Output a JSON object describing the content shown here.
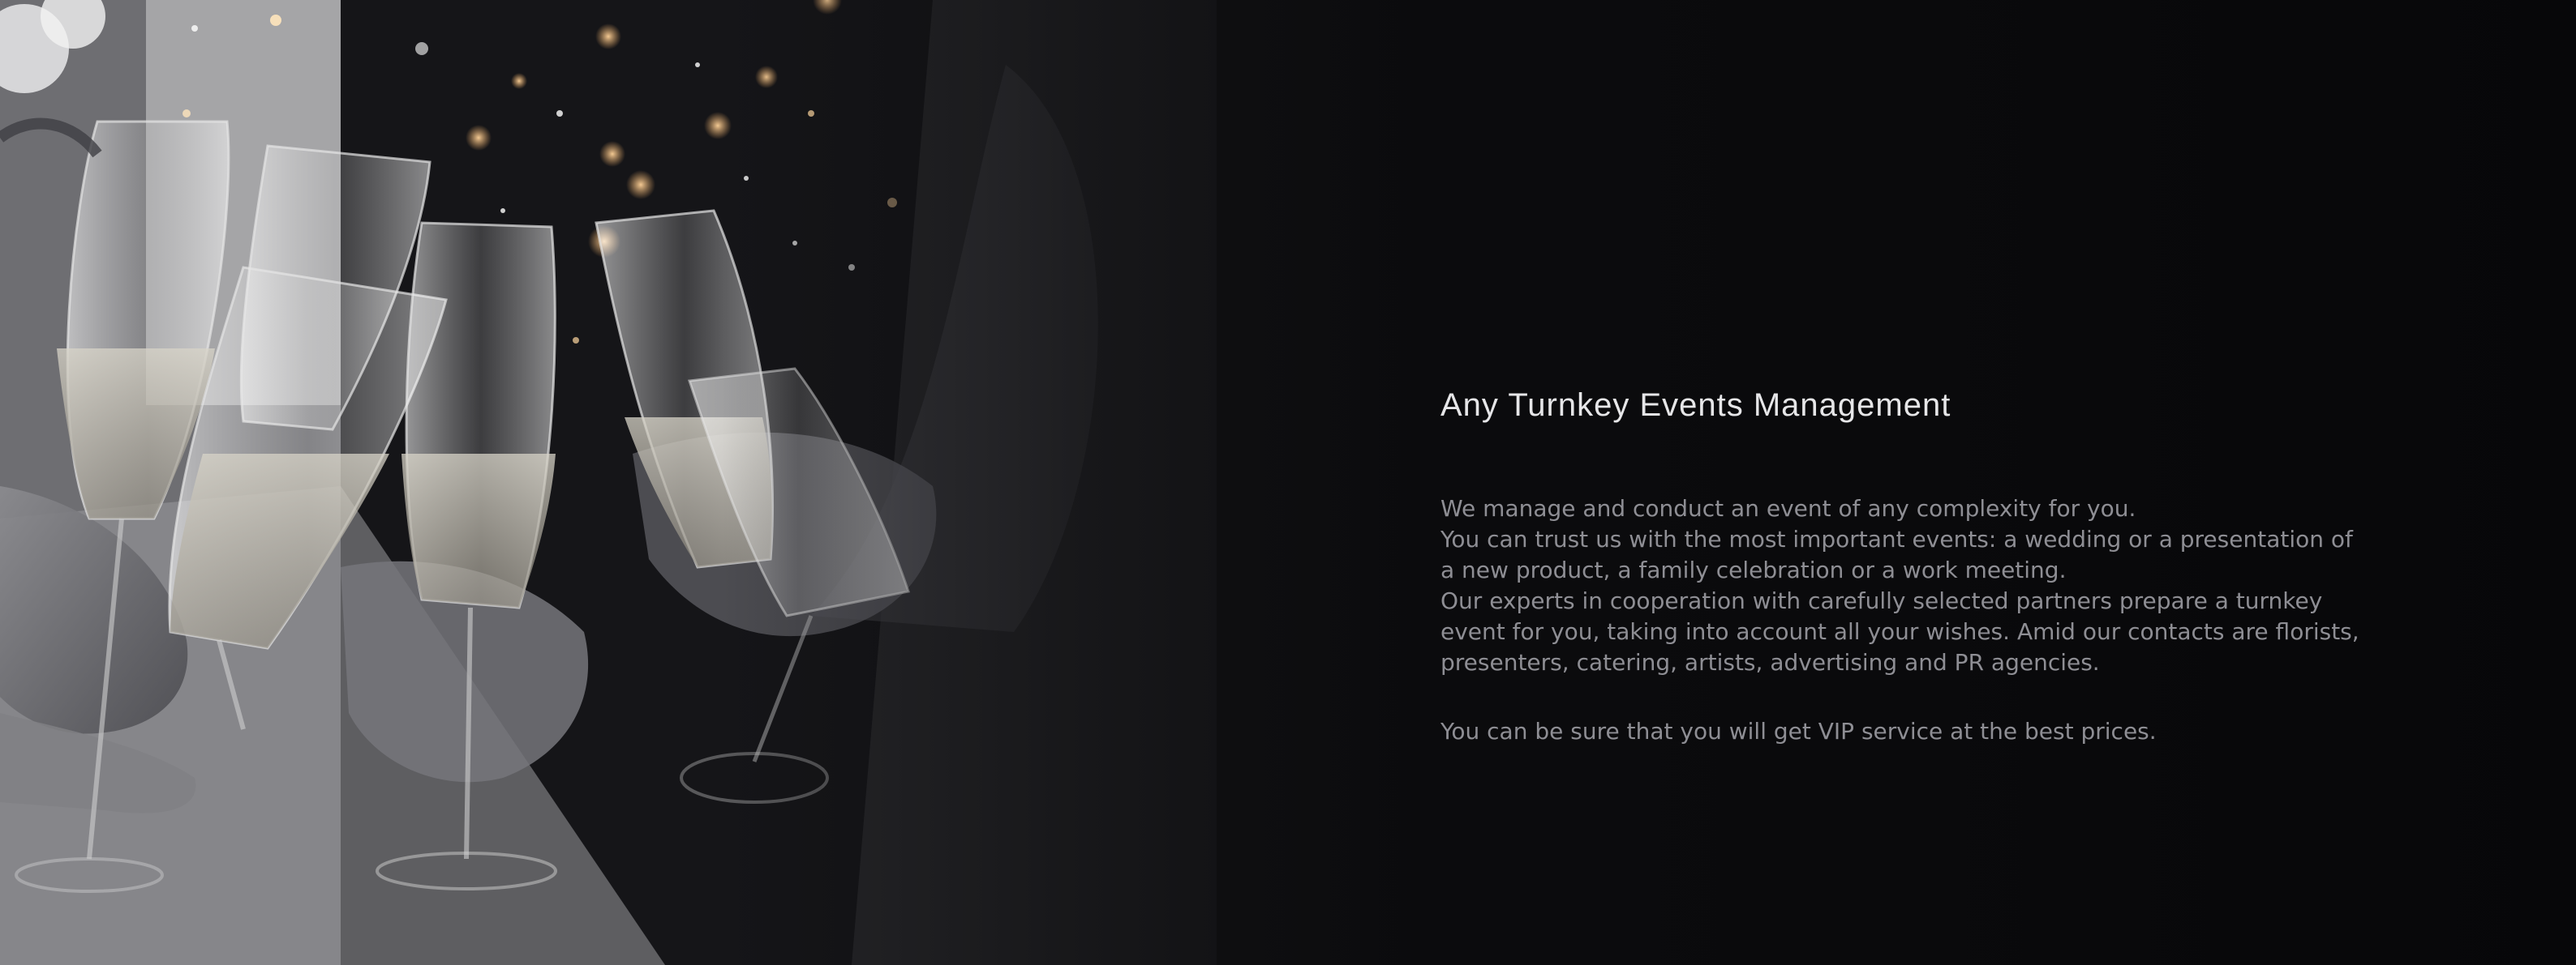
{
  "section": {
    "image": {
      "alt": "",
      "icon": "champagne-toast-photo"
    },
    "title": "Any Turnkey Events Management",
    "paragraphs": [
      [
        "We manage and conduct an event of any complexity for you.",
        "You can trust us with the most important events: a wedding or a presentation of",
        "a new product, a family celebration or a work meeting.",
        "Our experts in cooperation with carefully selected partners prepare a turnkey",
        "event for you, taking into account all your wishes. Amid our contacts are florists,",
        "presenters, catering, artists, advertising and PR agencies."
      ],
      [
        "You can be sure that you will get VIP service at the best prices."
      ]
    ]
  },
  "colors": {
    "background": "#0b0b0d",
    "title": "#e6e6e8",
    "body_text": "#8e8e94",
    "bokeh": "#e8a760"
  }
}
